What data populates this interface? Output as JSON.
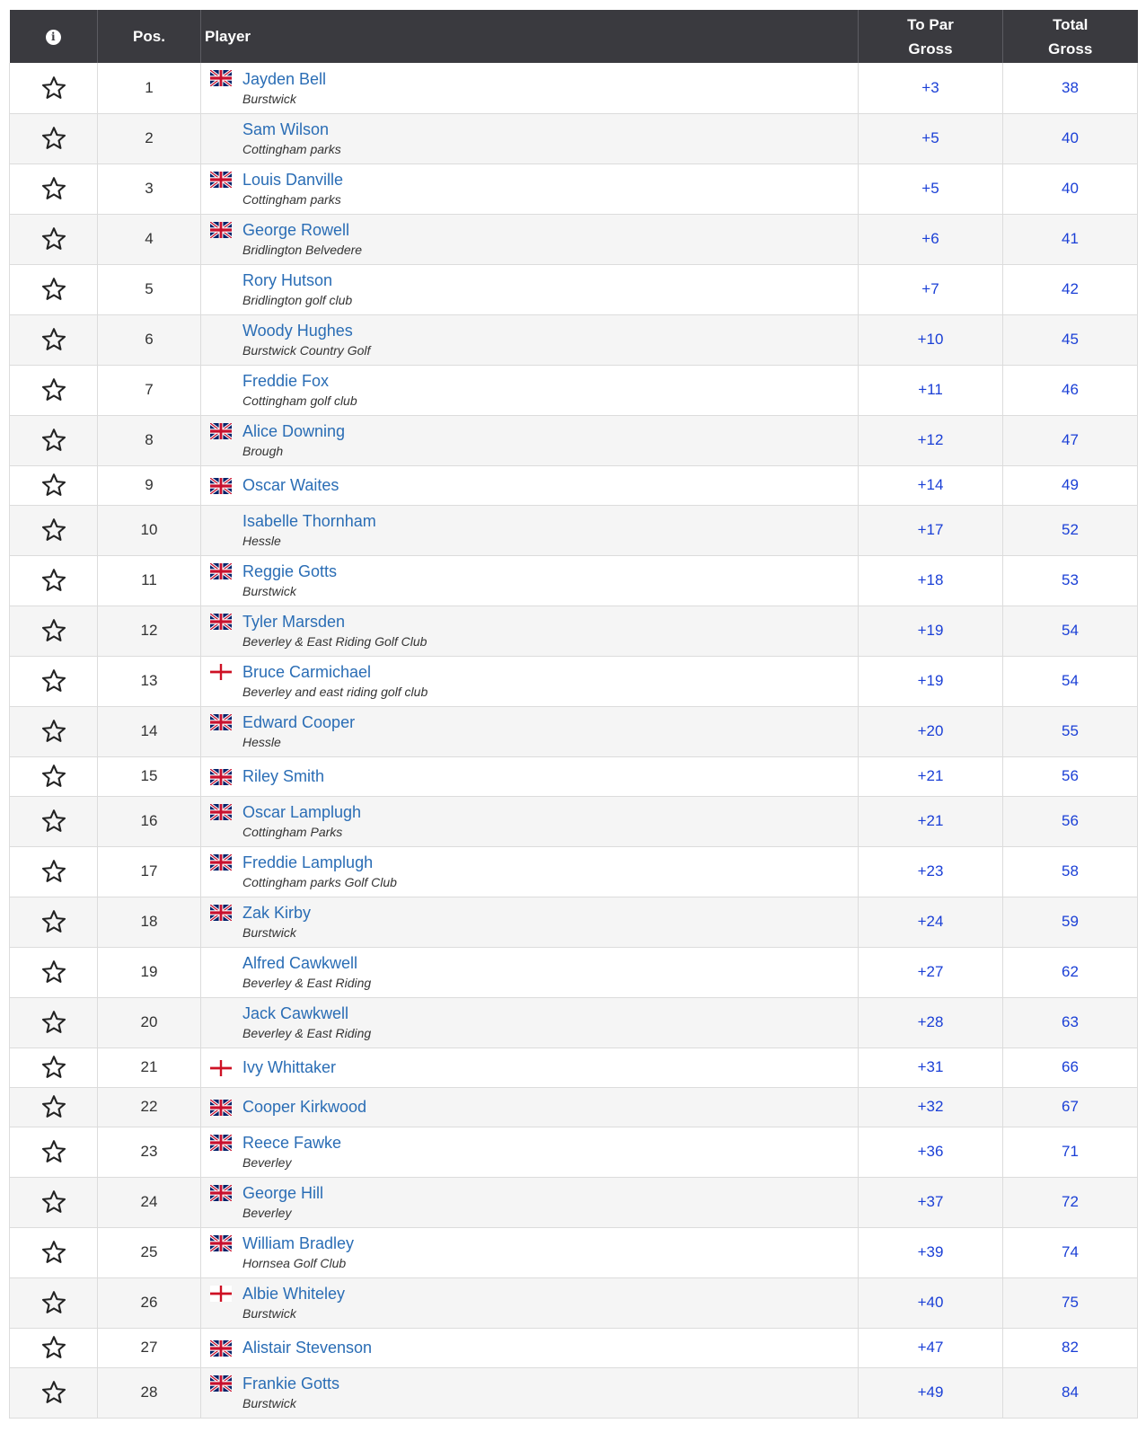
{
  "header": {
    "info_icon": "info-icon",
    "pos": "Pos.",
    "player": "Player",
    "to_par_line1": "To Par",
    "to_par_line2": "Gross",
    "total_line1": "Total",
    "total_line2": "Gross"
  },
  "colors": {
    "header_bg": "#3a3a3f",
    "name_link": "#2a6db5",
    "score": "#1a3fd6",
    "row_alt": "#f5f5f5"
  },
  "rows": [
    {
      "pos": "1",
      "name": "Jayden Bell",
      "club": "Burstwick",
      "flag": "uk",
      "to_par": "+3",
      "total": "38"
    },
    {
      "pos": "2",
      "name": "Sam Wilson",
      "club": "Cottingham parks",
      "flag": "",
      "to_par": "+5",
      "total": "40"
    },
    {
      "pos": "3",
      "name": "Louis Danville",
      "club": "Cottingham parks",
      "flag": "uk",
      "to_par": "+5",
      "total": "40"
    },
    {
      "pos": "4",
      "name": "George Rowell",
      "club": "Bridlington Belvedere",
      "flag": "uk",
      "to_par": "+6",
      "total": "41"
    },
    {
      "pos": "5",
      "name": "Rory Hutson",
      "club": "Bridlington golf club",
      "flag": "",
      "to_par": "+7",
      "total": "42"
    },
    {
      "pos": "6",
      "name": "Woody Hughes",
      "club": "Burstwick Country Golf",
      "flag": "",
      "to_par": "+10",
      "total": "45"
    },
    {
      "pos": "7",
      "name": "Freddie Fox",
      "club": "Cottingham golf club",
      "flag": "",
      "to_par": "+11",
      "total": "46"
    },
    {
      "pos": "8",
      "name": "Alice Downing",
      "club": "Brough",
      "flag": "uk",
      "to_par": "+12",
      "total": "47"
    },
    {
      "pos": "9",
      "name": "Oscar Waites",
      "club": "",
      "flag": "uk",
      "to_par": "+14",
      "total": "49"
    },
    {
      "pos": "10",
      "name": "Isabelle Thornham",
      "club": "Hessle",
      "flag": "",
      "to_par": "+17",
      "total": "52"
    },
    {
      "pos": "11",
      "name": "Reggie Gotts",
      "club": "Burstwick",
      "flag": "uk",
      "to_par": "+18",
      "total": "53"
    },
    {
      "pos": "12",
      "name": "Tyler Marsden",
      "club": "Beverley & East Riding Golf Club",
      "flag": "uk",
      "to_par": "+19",
      "total": "54"
    },
    {
      "pos": "13",
      "name": "Bruce Carmichael",
      "club": "Beverley and east riding golf club",
      "flag": "england",
      "to_par": "+19",
      "total": "54"
    },
    {
      "pos": "14",
      "name": "Edward Cooper",
      "club": "Hessle",
      "flag": "uk",
      "to_par": "+20",
      "total": "55"
    },
    {
      "pos": "15",
      "name": "Riley Smith",
      "club": "",
      "flag": "uk",
      "to_par": "+21",
      "total": "56"
    },
    {
      "pos": "16",
      "name": "Oscar Lamplugh",
      "club": "Cottingham Parks",
      "flag": "uk",
      "to_par": "+21",
      "total": "56"
    },
    {
      "pos": "17",
      "name": "Freddie Lamplugh",
      "club": "Cottingham parks Golf Club",
      "flag": "uk",
      "to_par": "+23",
      "total": "58"
    },
    {
      "pos": "18",
      "name": "Zak Kirby",
      "club": "Burstwick",
      "flag": "uk",
      "to_par": "+24",
      "total": "59"
    },
    {
      "pos": "19",
      "name": "Alfred Cawkwell",
      "club": "Beverley & East Riding",
      "flag": "",
      "to_par": "+27",
      "total": "62"
    },
    {
      "pos": "20",
      "name": "Jack Cawkwell",
      "club": "Beverley & East Riding",
      "flag": "",
      "to_par": "+28",
      "total": "63"
    },
    {
      "pos": "21",
      "name": "Ivy Whittaker",
      "club": "",
      "flag": "england",
      "to_par": "+31",
      "total": "66"
    },
    {
      "pos": "22",
      "name": "Cooper Kirkwood",
      "club": "",
      "flag": "uk",
      "to_par": "+32",
      "total": "67"
    },
    {
      "pos": "23",
      "name": "Reece Fawke",
      "club": "Beverley",
      "flag": "uk",
      "to_par": "+36",
      "total": "71"
    },
    {
      "pos": "24",
      "name": "George Hill",
      "club": "Beverley",
      "flag": "uk",
      "to_par": "+37",
      "total": "72"
    },
    {
      "pos": "25",
      "name": "William Bradley",
      "club": "Hornsea Golf Club",
      "flag": "uk",
      "to_par": "+39",
      "total": "74"
    },
    {
      "pos": "26",
      "name": "Albie Whiteley",
      "club": "Burstwick",
      "flag": "england",
      "to_par": "+40",
      "total": "75"
    },
    {
      "pos": "27",
      "name": "Alistair Stevenson",
      "club": "",
      "flag": "uk",
      "to_par": "+47",
      "total": "82"
    },
    {
      "pos": "28",
      "name": "Frankie Gotts",
      "club": "Burstwick",
      "flag": "uk",
      "to_par": "+49",
      "total": "84"
    }
  ]
}
